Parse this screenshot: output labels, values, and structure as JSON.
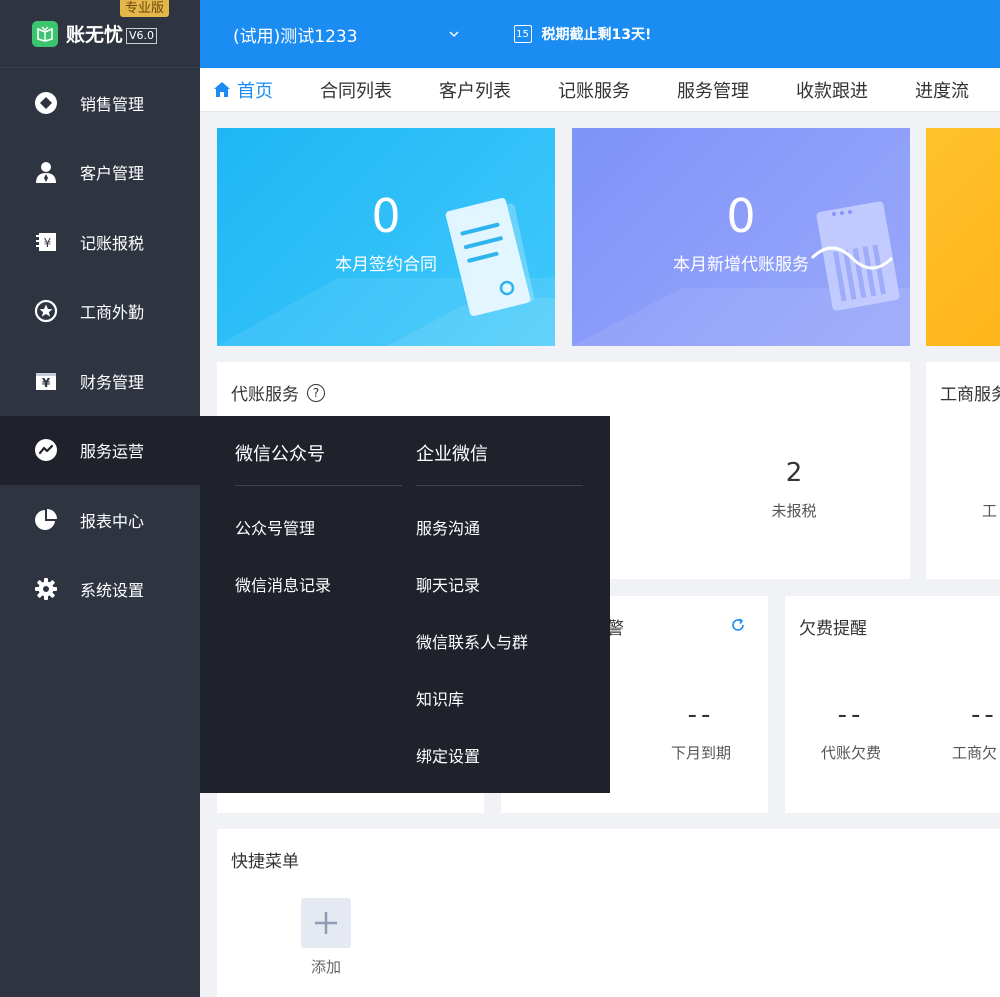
{
  "app": {
    "name": "账无忧",
    "version": "V6.0",
    "edition": "专业版"
  },
  "header": {
    "org_name": "(试用)测试1233",
    "calendar_day": "15",
    "tax_notice": "税期截止剩13天!"
  },
  "sidebar": {
    "items": [
      {
        "label": "销售管理",
        "icon": "diamond-icon"
      },
      {
        "label": "客户管理",
        "icon": "person-icon"
      },
      {
        "label": "记账报税",
        "icon": "ledger-icon"
      },
      {
        "label": "工商外勤",
        "icon": "star-badge-icon"
      },
      {
        "label": "财务管理",
        "icon": "yen-box-icon"
      },
      {
        "label": "服务运营",
        "icon": "trend-icon",
        "active": true
      },
      {
        "label": "报表中心",
        "icon": "pie-icon"
      },
      {
        "label": "系统设置",
        "icon": "gear-icon"
      }
    ]
  },
  "tabs": [
    "首页",
    "合同列表",
    "客户列表",
    "记账服务",
    "服务管理",
    "收款跟进",
    "进度流"
  ],
  "stats": [
    {
      "value": "0",
      "label": "本月签约合同"
    },
    {
      "value": "0",
      "label": "本月新增代账服务"
    }
  ],
  "accounting_card": {
    "title": "代账服务",
    "help": "?",
    "metric_value": "2",
    "metric_label": "未报税"
  },
  "business_card": {
    "title": "工商服务",
    "label": "工"
  },
  "expiry_card": {
    "title_tail": "警",
    "metric_value": "--",
    "metric_label": "下月到期"
  },
  "arrears_card": {
    "title": "欠费提醒",
    "metrics": [
      {
        "value": "--",
        "label": "代账欠费"
      },
      {
        "value": "--",
        "label": "工商欠"
      }
    ]
  },
  "quick_menu": {
    "title": "快捷菜单",
    "add_label": "添加"
  },
  "dropdown": {
    "col1": {
      "heading": "微信公众号",
      "items": [
        "公众号管理",
        "微信消息记录"
      ]
    },
    "col2": {
      "heading": "企业微信",
      "items": [
        "服务沟通",
        "聊天记录",
        "微信联系人与群",
        "知识库",
        "绑定设置"
      ]
    }
  },
  "colors": {
    "primary": "#1a8cf2",
    "sidebar_bg": "#2f3441",
    "dropdown_bg": "#1f222b",
    "card_blue": "#29bdf8",
    "card_purple": "#8d9ef9",
    "card_orange": "#ffbb22"
  }
}
